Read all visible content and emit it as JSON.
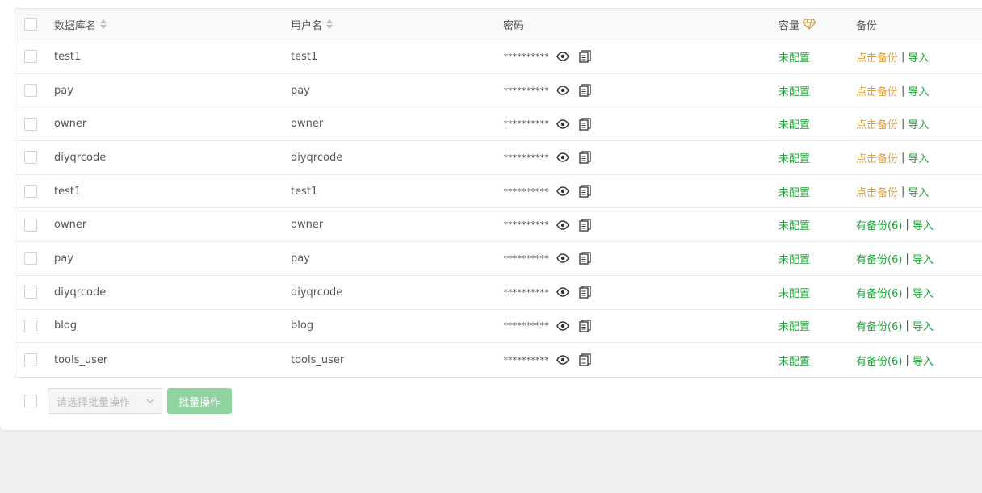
{
  "header": {
    "db_name": "数据库名",
    "username": "用户名",
    "password": "密码",
    "capacity": "容量",
    "backup": "备份"
  },
  "rows": [
    {
      "db": "test1",
      "user": "test1",
      "password": "**********",
      "capacity": "未配置",
      "backup": "点击备份",
      "backup_status": "none",
      "import": "导入"
    },
    {
      "db": "pay",
      "user": "pay",
      "password": "**********",
      "capacity": "未配置",
      "backup": "点击备份",
      "backup_status": "none",
      "import": "导入"
    },
    {
      "db": "owner",
      "user": "owner",
      "password": "**********",
      "capacity": "未配置",
      "backup": "点击备份",
      "backup_status": "none",
      "import": "导入"
    },
    {
      "db": "diyqrcode",
      "user": "diyqrcode",
      "password": "**********",
      "capacity": "未配置",
      "backup": "点击备份",
      "backup_status": "none",
      "import": "导入"
    },
    {
      "db": "test1",
      "user": "test1",
      "password": "**********",
      "capacity": "未配置",
      "backup": "点击备份",
      "backup_status": "none",
      "import": "导入"
    },
    {
      "db": "owner",
      "user": "owner",
      "password": "**********",
      "capacity": "未配置",
      "backup": "有备份(6)",
      "backup_status": "has",
      "import": "导入"
    },
    {
      "db": "pay",
      "user": "pay",
      "password": "**********",
      "capacity": "未配置",
      "backup": "有备份(6)",
      "backup_status": "has",
      "import": "导入"
    },
    {
      "db": "diyqrcode",
      "user": "diyqrcode",
      "password": "**********",
      "capacity": "未配置",
      "backup": "有备份(6)",
      "backup_status": "has",
      "import": "导入"
    },
    {
      "db": "blog",
      "user": "blog",
      "password": "**********",
      "capacity": "未配置",
      "backup": "有备份(6)",
      "backup_status": "has",
      "import": "导入"
    },
    {
      "db": "tools_user",
      "user": "tools_user",
      "password": "**********",
      "capacity": "未配置",
      "backup": "有备份(6)",
      "backup_status": "has",
      "import": "导入"
    }
  ],
  "footer": {
    "batch_select_placeholder": "请选择批量操作",
    "batch_button": "批量操作"
  },
  "colors": {
    "green": "#20a53a",
    "orange": "#e6a23c",
    "button_disabled": "#8fd3a0"
  },
  "icons": {
    "view_password": "eye-icon",
    "copy_password": "copy-icon",
    "capacity_hint": "gem-icon",
    "sort": "sort-icon",
    "dropdown": "chevron-down-icon"
  }
}
